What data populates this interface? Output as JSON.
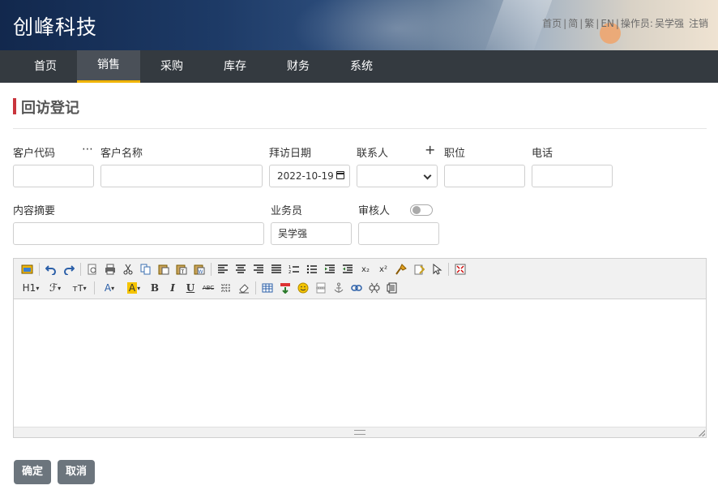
{
  "header": {
    "logo": "创峰科技",
    "links": {
      "home": "首页",
      "simplified": "简",
      "traditional": "繁",
      "english": "EN",
      "operator_label": "操作员:",
      "operator_name": "吴学强",
      "logout": "注销"
    }
  },
  "nav": {
    "items": [
      {
        "label": "首页",
        "active": false
      },
      {
        "label": "销售",
        "active": true
      },
      {
        "label": "采购",
        "active": false
      },
      {
        "label": "库存",
        "active": false
      },
      {
        "label": "财务",
        "active": false
      },
      {
        "label": "系统",
        "active": false
      }
    ],
    "active_color": "#f0b400"
  },
  "page": {
    "title": "回访登记",
    "accent_color": "#c9353d"
  },
  "form": {
    "customer_code": {
      "label": "客户代码",
      "value": ""
    },
    "more_icon": "⋯",
    "customer_name": {
      "label": "客户名称",
      "value": ""
    },
    "visit_date": {
      "label": "拜访日期",
      "value": "2022-10-19"
    },
    "contact": {
      "label": "联系人",
      "value": ""
    },
    "add_icon": "+",
    "position": {
      "label": "职位",
      "value": ""
    },
    "phone": {
      "label": "电话",
      "value": ""
    },
    "summary": {
      "label": "内容摘要",
      "value": ""
    },
    "salesperson": {
      "label": "业务员",
      "value": "吴学强"
    },
    "reviewer": {
      "label": "审核人",
      "value": "",
      "toggle_on": false
    }
  },
  "editor_toolbar": {
    "heading": "H1",
    "font": "ℱ",
    "size": "тT",
    "font_color": "A",
    "bg_color": "A",
    "bold": "B",
    "italic": "I",
    "underline": "U",
    "strike": "ABC",
    "subscript": "x₂",
    "superscript": "x²"
  },
  "buttons": {
    "confirm": "确定",
    "cancel": "取消"
  }
}
